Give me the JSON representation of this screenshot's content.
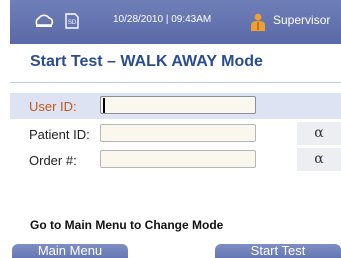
{
  "status_bar": {
    "timestamp": "10/28/2010 | 09:43AM",
    "role": "Supervisor",
    "icons": [
      "cloud-connection-icon",
      "sd-card-icon",
      "supervisor-user-icon"
    ],
    "sd_label": "SD"
  },
  "page": {
    "title": "Start Test – WALK AWAY Mode"
  },
  "form": {
    "user_id_label": "User ID:",
    "user_id_value": "",
    "patient_id_label": "Patient ID:",
    "patient_id_value": "",
    "order_label": "Order #:",
    "order_value": "",
    "alpha_label": "α"
  },
  "hint": "Go to Main Menu to Change Mode",
  "buttons": {
    "main_menu": "Main Menu",
    "start_test": "Start Test"
  },
  "colors": {
    "header_bg": "#6474b0",
    "title": "#2b4c8f",
    "active_label": "#c25a1a",
    "active_row": "#dde3f3"
  }
}
